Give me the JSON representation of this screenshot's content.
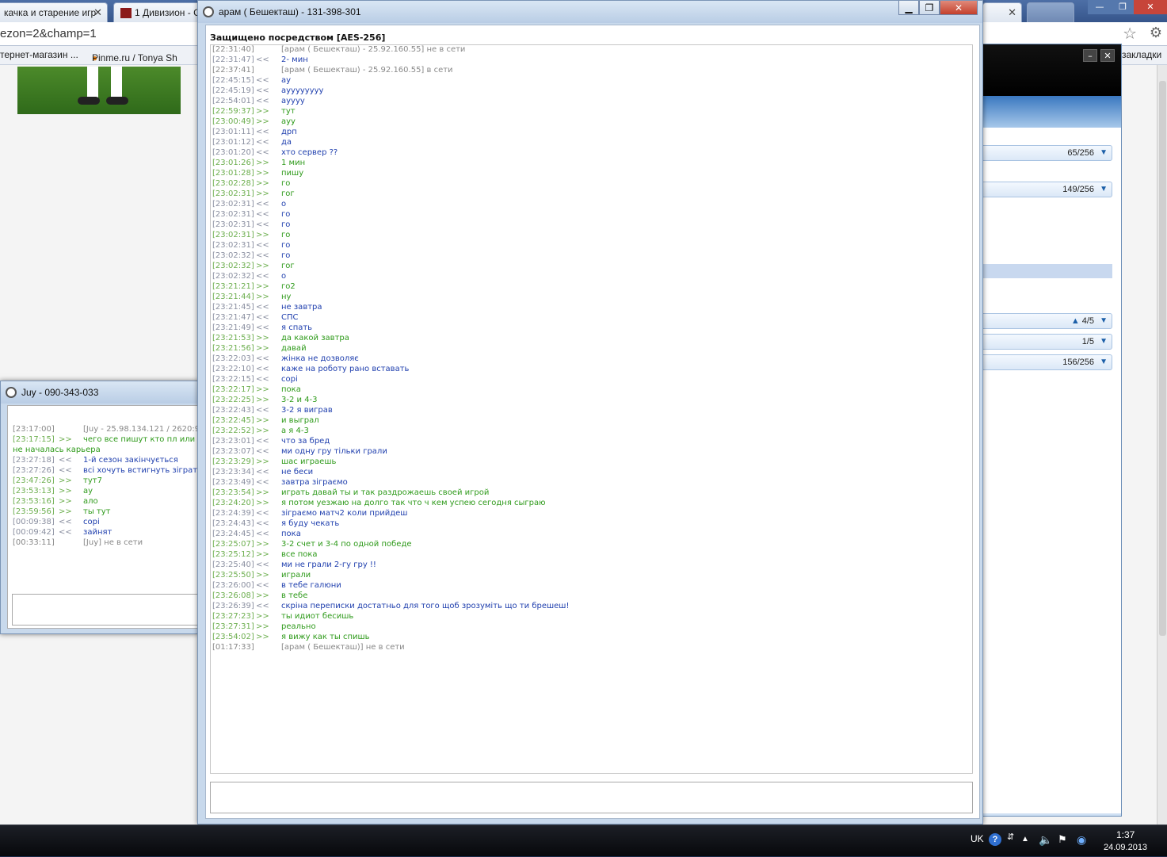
{
  "browser": {
    "tabs": [
      "качка и старение игр",
      "1 Дивизион - С"
    ],
    "url": "ezon=2&champ=1",
    "bookmarks": [
      "тернет-магазин ...",
      "Pinme.ru / Tonya Sh",
      "закладки"
    ]
  },
  "side_app": {
    "rows": [
      {
        "value": "65/256"
      },
      {
        "value": "149/256"
      },
      {
        "value": "4/5",
        "warning": true
      },
      {
        "value": "1/5"
      },
      {
        "value": "156/256"
      }
    ]
  },
  "main_chat": {
    "title": "арам ( Бешекташ) - 131-398-301",
    "security": "Защищено посредством [AES-256]",
    "messages": [
      {
        "time": "[22:31:40]",
        "dir": "",
        "text": "[арам ( Бешекташ) - 25.92.160.55] не в сети",
        "kind": "sys"
      },
      {
        "time": "[22:31:47]",
        "dir": "<<",
        "text": "2- мин",
        "kind": "in"
      },
      {
        "time": "[22:37:41]",
        "dir": "",
        "text": "[арам ( Бешекташ) - 25.92.160.55] в сети",
        "kind": "sys"
      },
      {
        "time": "[22:45:15]",
        "dir": "<<",
        "text": "ау",
        "kind": "in"
      },
      {
        "time": "[22:45:19]",
        "dir": "<<",
        "text": "ауууууууу",
        "kind": "in"
      },
      {
        "time": "[22:54:01]",
        "dir": "<<",
        "text": "аyyyy",
        "kind": "in"
      },
      {
        "time": "[22:59:37]",
        "dir": ">>",
        "text": "тут",
        "kind": "out"
      },
      {
        "time": "[23:00:49]",
        "dir": ">>",
        "text": "ауу",
        "kind": "out"
      },
      {
        "time": "[23:01:11]",
        "dir": "<<",
        "text": "дрп",
        "kind": "in"
      },
      {
        "time": "[23:01:12]",
        "dir": "<<",
        "text": "да",
        "kind": "in"
      },
      {
        "time": "[23:01:20]",
        "dir": "<<",
        "text": "хто сервер ??",
        "kind": "in"
      },
      {
        "time": "[23:01:26]",
        "dir": ">>",
        "text": "1 мин",
        "kind": "out"
      },
      {
        "time": "[23:01:28]",
        "dir": ">>",
        "text": "пишу",
        "kind": "out"
      },
      {
        "time": "[23:02:28]",
        "dir": ">>",
        "text": "го",
        "kind": "out"
      },
      {
        "time": "[23:02:31]",
        "dir": ">>",
        "text": "гог",
        "kind": "out"
      },
      {
        "time": "[23:02:31]",
        "dir": "<<",
        "text": "о",
        "kind": "in"
      },
      {
        "time": "[23:02:31]",
        "dir": "<<",
        "text": "го",
        "kind": "in"
      },
      {
        "time": "[23:02:31]",
        "dir": "<<",
        "text": "го",
        "kind": "in"
      },
      {
        "time": "[23:02:31]",
        "dir": ">>",
        "text": "го",
        "kind": "out"
      },
      {
        "time": "[23:02:31]",
        "dir": "<<",
        "text": "го",
        "kind": "in"
      },
      {
        "time": "[23:02:32]",
        "dir": "<<",
        "text": "го",
        "kind": "in"
      },
      {
        "time": "[23:02:32]",
        "dir": ">>",
        "text": "гог",
        "kind": "out"
      },
      {
        "time": "[23:02:32]",
        "dir": "<<",
        "text": "о",
        "kind": "in"
      },
      {
        "time": "[23:21:21]",
        "dir": ">>",
        "text": "го2",
        "kind": "out"
      },
      {
        "time": "[23:21:44]",
        "dir": ">>",
        "text": "ну",
        "kind": "out"
      },
      {
        "time": "[23:21:45]",
        "dir": "<<",
        "text": "не завтра",
        "kind": "in"
      },
      {
        "time": "[23:21:47]",
        "dir": "<<",
        "text": "СПС",
        "kind": "in"
      },
      {
        "time": "[23:21:49]",
        "dir": "<<",
        "text": "я спать",
        "kind": "in"
      },
      {
        "time": "[23:21:53]",
        "dir": ">>",
        "text": "да какой завтра",
        "kind": "out"
      },
      {
        "time": "[23:21:56]",
        "dir": ">>",
        "text": "давай",
        "kind": "out"
      },
      {
        "time": "[23:22:03]",
        "dir": "<<",
        "text": "жінка не дозволяє",
        "kind": "in"
      },
      {
        "time": "[23:22:10]",
        "dir": "<<",
        "text": "каже на роботу рано вставать",
        "kind": "in"
      },
      {
        "time": "[23:22:15]",
        "dir": "<<",
        "text": "сорі",
        "kind": "in"
      },
      {
        "time": "[23:22:17]",
        "dir": ">>",
        "text": "пока",
        "kind": "out"
      },
      {
        "time": "[23:22:25]",
        "dir": ">>",
        "text": "3-2 и 4-3",
        "kind": "out"
      },
      {
        "time": "[23:22:43]",
        "dir": "<<",
        "text": "3-2 я виграв",
        "kind": "in"
      },
      {
        "time": "[23:22:45]",
        "dir": ">>",
        "text": "и выграл",
        "kind": "out"
      },
      {
        "time": "[23:22:52]",
        "dir": ">>",
        "text": "а я 4-3",
        "kind": "out"
      },
      {
        "time": "[23:23:01]",
        "dir": "<<",
        "text": "что за бред",
        "kind": "in"
      },
      {
        "time": "[23:23:07]",
        "dir": "<<",
        "text": "ми одну гру тільки грали",
        "kind": "in"
      },
      {
        "time": "[23:23:29]",
        "dir": ">>",
        "text": "шас играешь",
        "kind": "out"
      },
      {
        "time": "[23:23:34]",
        "dir": "<<",
        "text": "не беси",
        "kind": "in"
      },
      {
        "time": "[23:23:49]",
        "dir": "<<",
        "text": "завтра зіграємо",
        "kind": "in"
      },
      {
        "time": "[23:23:54]",
        "dir": ">>",
        "text": "играть давай ты и так раздрожаешь своей игрой",
        "kind": "out"
      },
      {
        "time": "[23:24:20]",
        "dir": ">>",
        "text": "я потом уезжаю на долго так что ч кем успею сегодня сыграю",
        "kind": "out"
      },
      {
        "time": "[23:24:39]",
        "dir": "<<",
        "text": "зіграємо матч2 коли прийдеш",
        "kind": "in"
      },
      {
        "time": "[23:24:43]",
        "dir": "<<",
        "text": "я буду чекать",
        "kind": "in"
      },
      {
        "time": "[23:24:45]",
        "dir": "<<",
        "text": "пока",
        "kind": "in"
      },
      {
        "time": "[23:25:07]",
        "dir": ">>",
        "text": "3-2 счет и 3-4 по одной победе",
        "kind": "out"
      },
      {
        "time": "[23:25:12]",
        "dir": ">>",
        "text": "все пока",
        "kind": "out"
      },
      {
        "time": "[23:25:40]",
        "dir": "<<",
        "text": "ми не грали 2-гу гру !!",
        "kind": "in"
      },
      {
        "time": "[23:25:50]",
        "dir": ">>",
        "text": "играли",
        "kind": "out"
      },
      {
        "time": "[23:26:00]",
        "dir": "<<",
        "text": "в тебе галюни",
        "kind": "in"
      },
      {
        "time": "[23:26:08]",
        "dir": ">>",
        "text": "в тебе",
        "kind": "out"
      },
      {
        "time": "[23:26:39]",
        "dir": "<<",
        "text": "скріна переписки достатньо для того щоб зрозуміть що ти брешеш!",
        "kind": "in"
      },
      {
        "time": "[23:27:23]",
        "dir": ">>",
        "text": "ты идиот бесишь",
        "kind": "out"
      },
      {
        "time": "[23:27:31]",
        "dir": ">>",
        "text": "реально",
        "kind": "out"
      },
      {
        "time": "[23:54:02]",
        "dir": ">>",
        "text": "я вижу как ты спишь",
        "kind": "out"
      },
      {
        "time": "[01:17:33]",
        "dir": "",
        "text": "[арам ( Бешекташ)] не в сети",
        "kind": "sys"
      }
    ]
  },
  "left_chat": {
    "title": "Juy - 090-343-033",
    "messages": [
      {
        "time": "[23:17:00]",
        "dir": "",
        "text": "[Juy - 25.98.134.121 / 2620:9",
        "kind": "sys"
      },
      {
        "time": "[23:17:15]",
        "dir": ">>",
        "text": "чего все пишут кто пл или 1",
        "kind": "out"
      },
      {
        "time": "",
        "dir": "",
        "text": "не началась карьера",
        "kind": "out"
      },
      {
        "time": "[23:27:18]",
        "dir": "<<",
        "text": "1-й сезон закінчується",
        "kind": "in"
      },
      {
        "time": "[23:27:26]",
        "dir": "<<",
        "text": "всі хочуть встигнуть зіграть",
        "kind": "in"
      },
      {
        "time": "[23:47:26]",
        "dir": ">>",
        "text": "тут7",
        "kind": "out"
      },
      {
        "time": "[23:53:13]",
        "dir": ">>",
        "text": "ау",
        "kind": "out"
      },
      {
        "time": "[23:53:16]",
        "dir": ">>",
        "text": "ало",
        "kind": "out"
      },
      {
        "time": "[23:59:56]",
        "dir": ">>",
        "text": "ты тут",
        "kind": "out"
      },
      {
        "time": "[00:09:38]",
        "dir": "<<",
        "text": "сорі",
        "kind": "in"
      },
      {
        "time": "[00:09:42]",
        "dir": "<<",
        "text": "зайнят",
        "kind": "in"
      },
      {
        "time": "[00:33:11]",
        "dir": "",
        "text": "[Juy] не в сети",
        "kind": "sys"
      }
    ]
  },
  "taskbar": {
    "lang": "UK",
    "time": "1:37",
    "date": "24.09.2013"
  }
}
